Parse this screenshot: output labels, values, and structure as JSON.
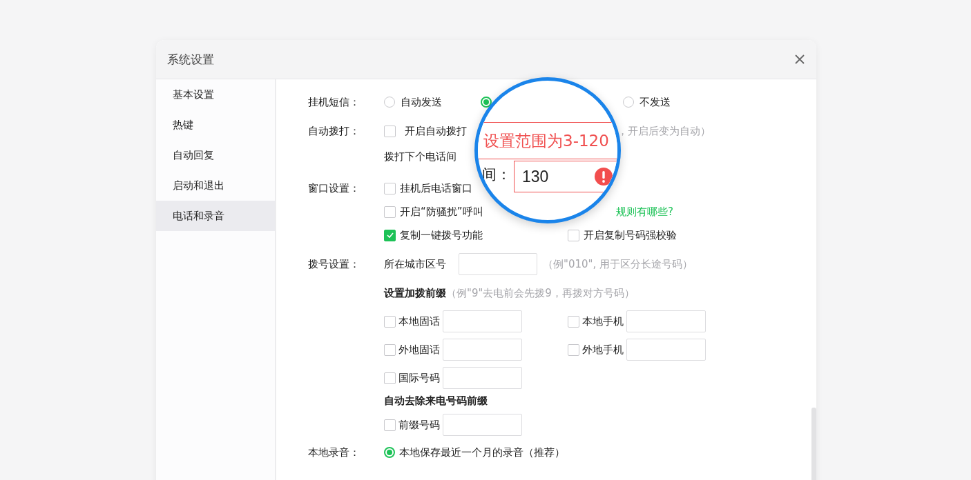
{
  "window": {
    "title": "系统设置"
  },
  "sidebar": {
    "items": [
      {
        "label": "基本设置",
        "selected": false
      },
      {
        "label": "热键",
        "selected": false
      },
      {
        "label": "自动回复",
        "selected": false
      },
      {
        "label": "启动和退出",
        "selected": false
      },
      {
        "label": "电话和录音",
        "selected": true
      }
    ]
  },
  "hangup_sms": {
    "label": "挂机短信：",
    "options": [
      {
        "label": "自动发送",
        "selected": false
      },
      {
        "selected": true
      },
      {
        "label": "不发送",
        "selected": false
      }
    ]
  },
  "auto_dial": {
    "label": "自动拨打：",
    "checkbox": {
      "label": "开启自动拨打",
      "checked": false
    },
    "note": "，开启后变为自动）",
    "interval_label": "拨打下个电话间"
  },
  "window_settings": {
    "label": "窗口设置：",
    "options": [
      {
        "label": "挂机后电话窗口",
        "checked": false
      },
      {
        "label": "开启“防骚扰”呼叫",
        "checked": false,
        "link": "规则有哪些?"
      },
      {
        "label": "复制一键拨号功能",
        "checked": true
      },
      {
        "label": "开启复制号码强校验",
        "checked": false
      }
    ]
  },
  "dial_settings": {
    "label": "拨号设置：",
    "area_code_label": "所在城市区号",
    "area_code_hint": "（例\"010\", 用于区分长途号码）",
    "prefix_title": "设置加拨前缀",
    "prefix_hint": "（例\"9\"去电前会先拨9，再拨对方号码）",
    "prefixes": [
      {
        "label": "本地固话",
        "checked": false
      },
      {
        "label": "本地手机",
        "checked": false
      },
      {
        "label": "外地固话",
        "checked": false
      },
      {
        "label": "外地手机",
        "checked": false
      },
      {
        "label": "国际号码",
        "checked": false
      }
    ],
    "strip_title": "自动去除来电号码前缀",
    "strip": [
      {
        "label": "前缀号码",
        "checked": false
      }
    ]
  },
  "local_recording": {
    "label": "本地录音：",
    "options": [
      {
        "label": "本地保存最近一个月的录音（推荐）",
        "selected": true
      }
    ]
  },
  "magnifier": {
    "tooltip": "设置范围为3-120",
    "field_label": "间：",
    "field_value": "130",
    "error": true
  }
}
